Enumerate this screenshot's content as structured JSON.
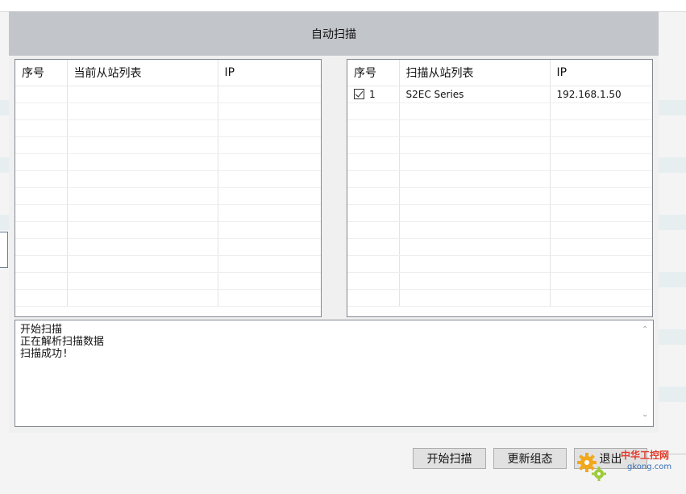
{
  "dialog": {
    "title": "自动扫描"
  },
  "current_slaves": {
    "columns": [
      "序号",
      "当前从站列表",
      "IP"
    ],
    "rows": []
  },
  "scanned_slaves": {
    "columns": [
      "序号",
      "扫描从站列表",
      "IP"
    ],
    "rows": [
      {
        "index": "1",
        "checked": true,
        "name": "S2EC Series",
        "ip": "192.168.1.50"
      }
    ]
  },
  "log": {
    "lines": [
      "开始扫描",
      "正在解析扫描数据",
      "扫描成功!"
    ]
  },
  "buttons": {
    "start_scan": "开始扫描",
    "update_config": "更新组态",
    "exit": "退出"
  },
  "watermark": {
    "cn": "中华工控网",
    "domain": "gkong.com"
  },
  "colors": {
    "header_bg": "#c2c5ca",
    "panel_border": "#828790",
    "watermark_red": "#e23b2a",
    "watermark_blue": "#3a6fb5"
  }
}
